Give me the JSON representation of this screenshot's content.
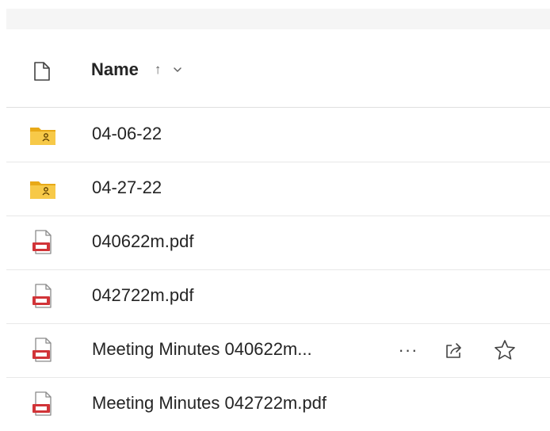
{
  "header": {
    "column_name": "Name",
    "sort_glyph": "↑",
    "file_type_icon": "document-icon",
    "chevron_icon": "chevron-down-icon"
  },
  "rows": [
    {
      "name": "04-06-22",
      "type": "shared-folder-icon"
    },
    {
      "name": "04-27-22",
      "type": "shared-folder-icon"
    },
    {
      "name": "040622m.pdf",
      "type": "pdf-icon"
    },
    {
      "name": "042722m.pdf",
      "type": "pdf-icon"
    },
    {
      "name": "Meeting Minutes 040622m...",
      "type": "pdf-icon",
      "hovered": true
    },
    {
      "name": "Meeting Minutes 042722m.pdf",
      "type": "pdf-icon"
    }
  ],
  "row_actions": {
    "more_glyph": "···",
    "share_icon": "share-icon",
    "favorite_icon": "star-icon"
  },
  "colors": {
    "folder": "#f7c948",
    "folder_dark": "#e8a917",
    "pdf_red": "#d13438",
    "divider": "#e8e8e8"
  }
}
